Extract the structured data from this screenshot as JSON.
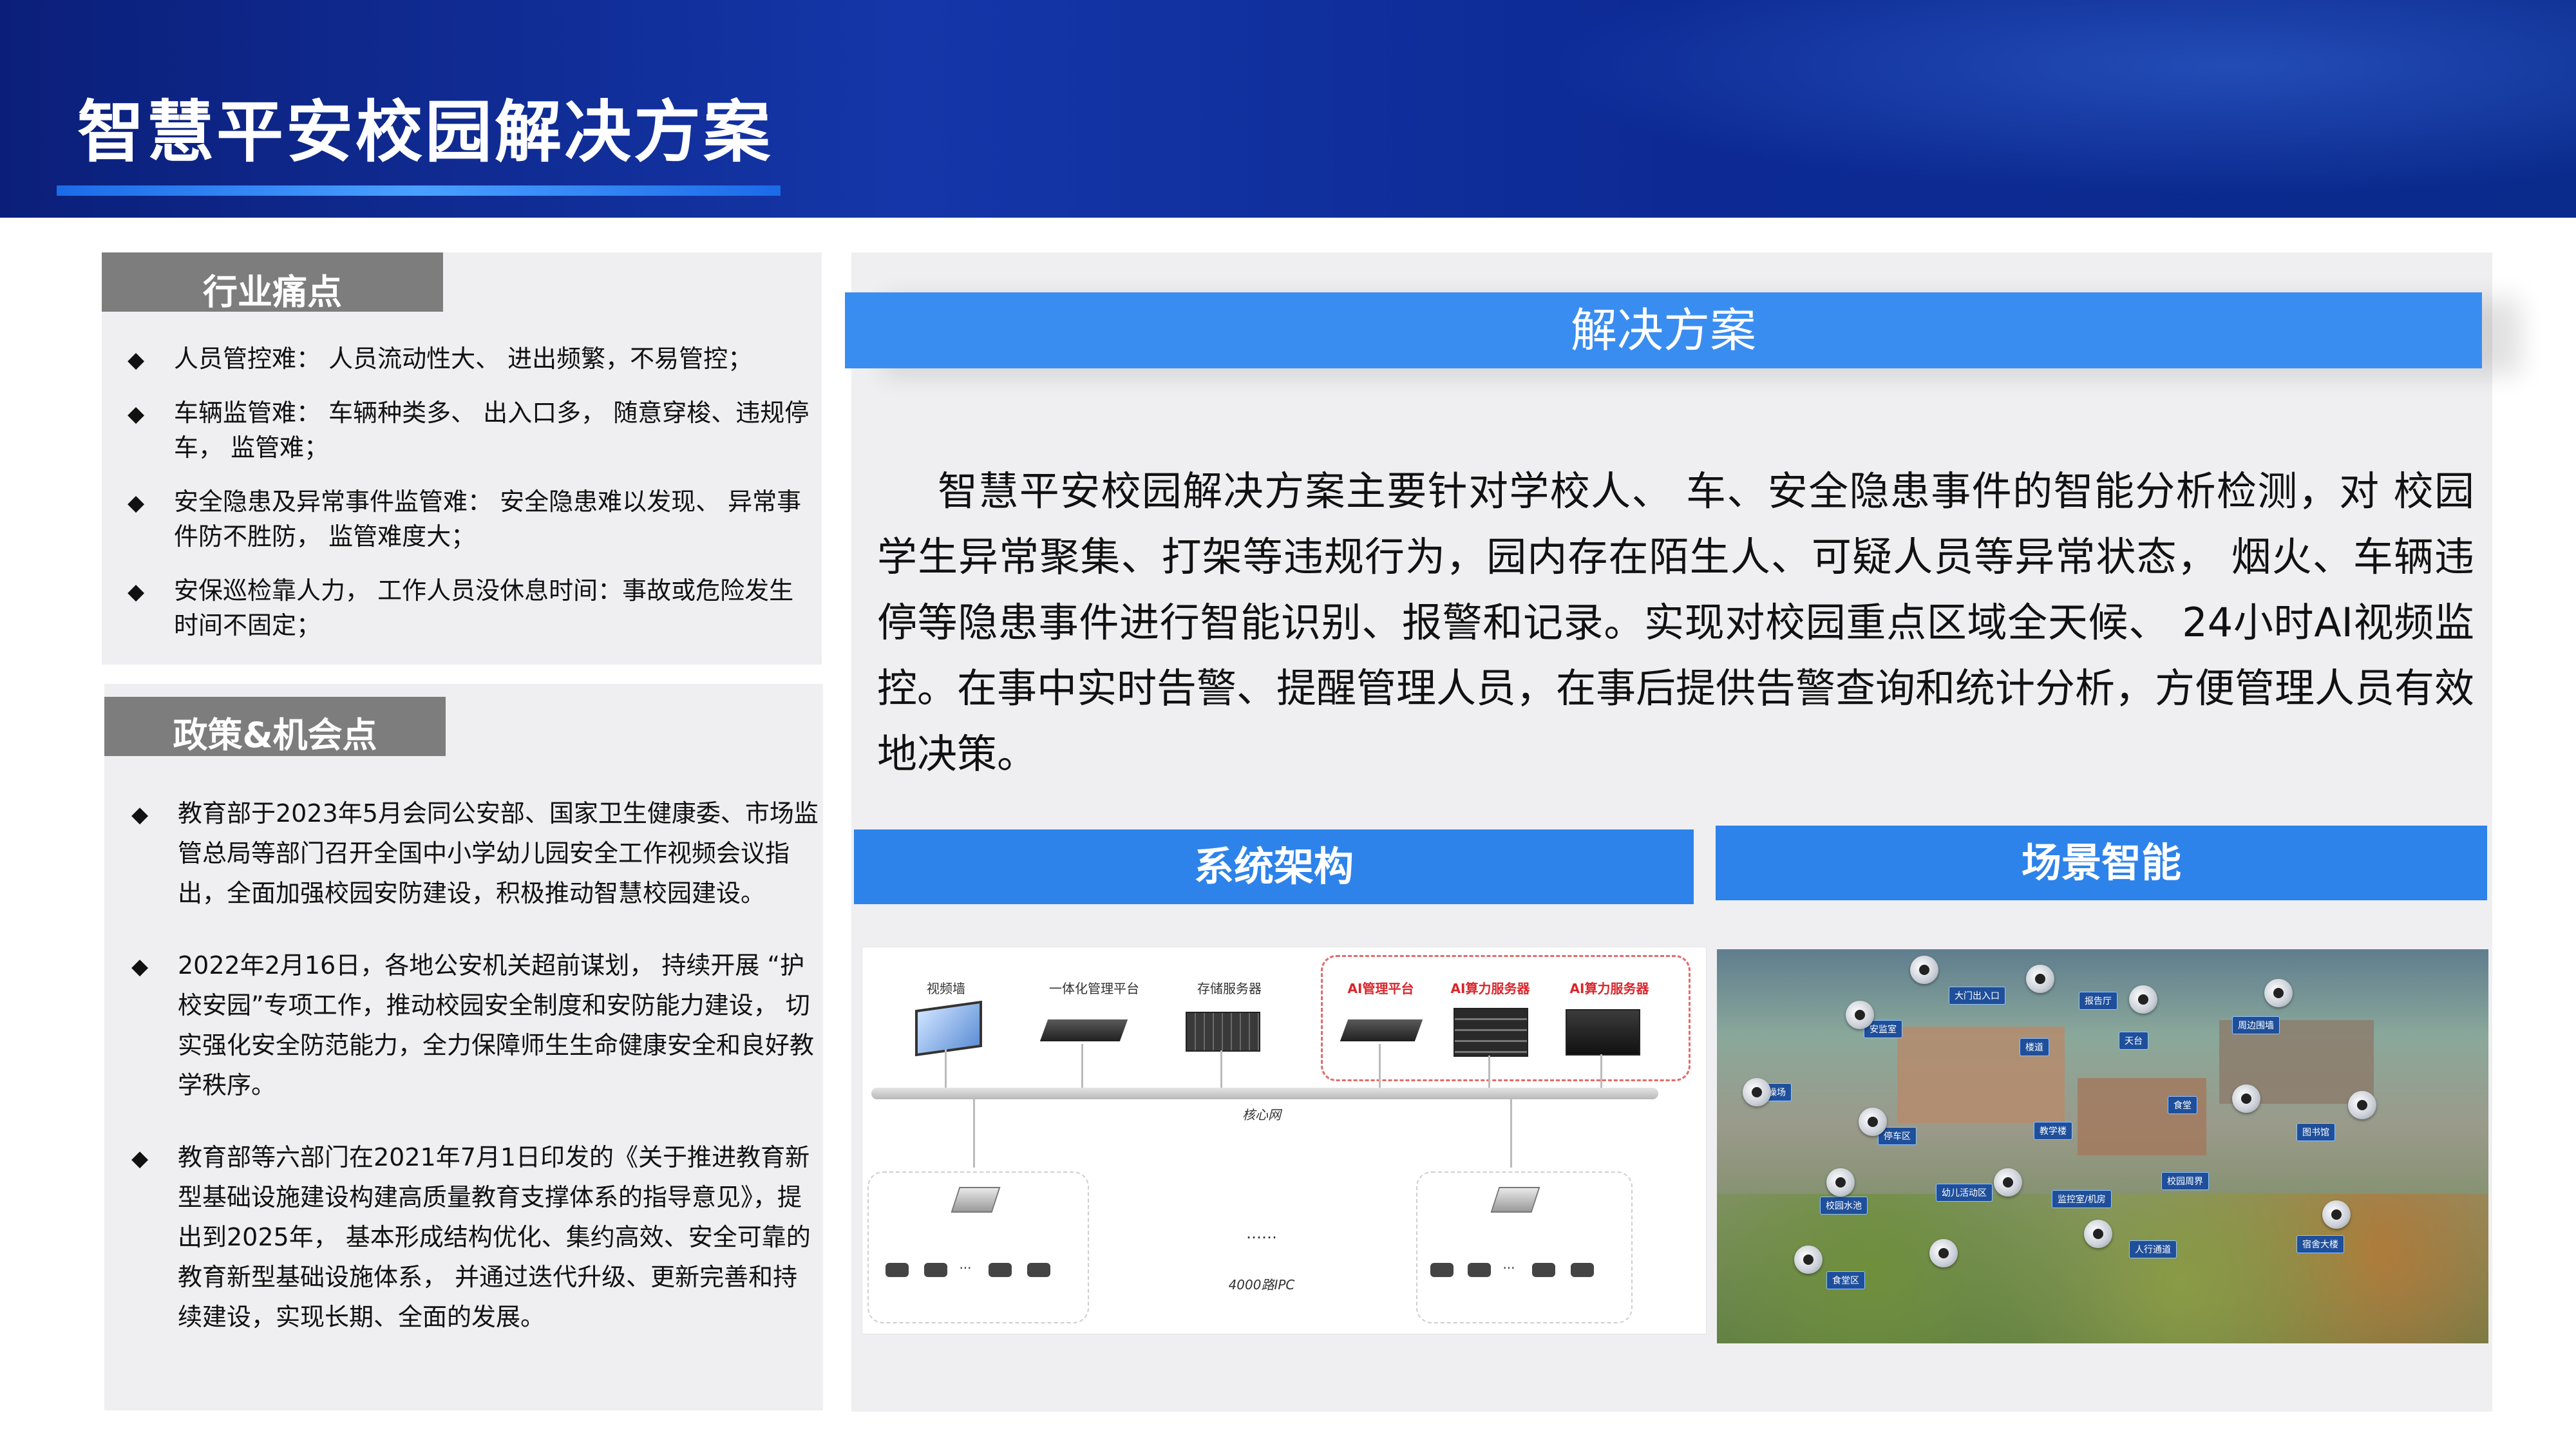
{
  "header": {
    "title": "智慧平安校园解决方案"
  },
  "pain": {
    "tab": "行业痛点",
    "items": [
      "人员管控难： 人员流动性大、 进出频繁，不易管控；",
      "车辆监管难： 车辆种类多、 出入口多， 随意穿梭、违规停车， 监管难；",
      "安全隐患及异常事件监管难： 安全隐患难以发现、 异常事件防不胜防， 监管难度大；",
      "安保巡检靠人力， 工作人员没休息时间：事故或危险发生时间不固定；"
    ]
  },
  "policy": {
    "tab": "政策&机会点",
    "items": [
      "教育部于2023年5月会同公安部、国家卫生健康委、市场监管总局等部门召开全国中小学幼儿园安全工作视频会议指出，全面加强校园安防建设，积极推动智慧校园建设。",
      "2022年2月16日，各地公安机关超前谋划， 持续开展 “护校安园”专项工作，推动校园安全制度和安防能力建设， 切实强化安全防范能力，全力保障师生生命健康安全和良好教学秩序。",
      "教育部等六部门在2021年7月1日印发的《关于推进教育新型基础设施建设构建高质量教育支撑体系的指导意见》，提出到2025年， 基本形成结构优化、集约高效、安全可靠的教育新型基础设施体系， 并通过迭代升级、更新完善和持续建设，实现长期、全面的发展。"
    ]
  },
  "solution": {
    "title": "解决方案",
    "text": "智慧平安校园解决方案主要针对学校人、 车、安全隐患事件的智能分析检测，对 校园学生异常聚集、打架等违规行为，园内存在陌生人、可疑人员等异常状态， 烟火、车辆违停等隐患事件进行智能识别、报警和记录。实现对校园重点区域全天候、 24小时AI视频监控。在事中实时告警、提醒管理人员，在事后提供告警查询和统计分析，方便管理人员有效地决策。"
  },
  "arch": {
    "title": "系统架构",
    "labels": {
      "video_wall": "视频墙",
      "platform": "一体化管理平台",
      "storage": "存储服务器",
      "ai_platform": "AI管理平台",
      "ai_server_1": "AI算力服务器",
      "ai_server_2": "AI算力服务器",
      "core_net": "核心网",
      "ellipsis": "……",
      "ipc": "4000路IPC",
      "dots_1": "...",
      "dots_2": "..."
    }
  },
  "scene": {
    "title": "场景智能",
    "tags": [
      "大门出入口",
      "报告厅",
      "安监室",
      "楼道",
      "天台",
      "周边围墙",
      "操场",
      "停车区",
      "教学楼",
      "图书馆",
      "食堂",
      "幼儿活动区",
      "监控室/机房",
      "校园周界",
      "校园水池",
      "人行通道",
      "宿舍大楼",
      "食堂区"
    ]
  },
  "colors": {
    "header_dark": "#0b1f7a",
    "accent_blue": "#2d83ea",
    "tab_gray": "#7d7d7d",
    "panel_bg": "#efeff1",
    "red_label": "#d8262c"
  }
}
